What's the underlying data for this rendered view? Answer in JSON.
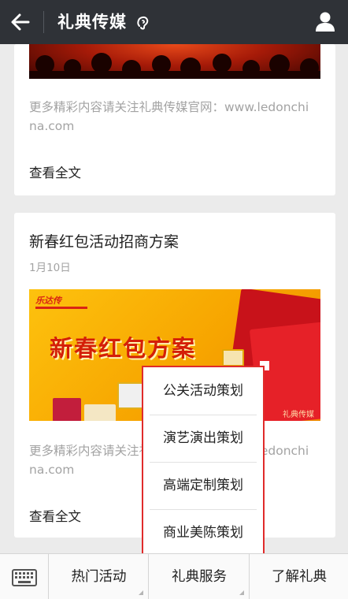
{
  "header": {
    "title": "礼典传媒"
  },
  "article1": {
    "summary": "更多精彩内容请关注礼典传媒官网：www.ledonchina.com",
    "read_more": "查看全文"
  },
  "article2": {
    "title": "新春红包活动招商方案",
    "date": "1月10日",
    "image_logo": "乐达传",
    "image_title": "新春红包方案",
    "image_corner": "礼典传媒",
    "summary": "更多精彩内容请关注礼典传媒官网：www.ledonchina.com",
    "read_more": "查看全文"
  },
  "popup_menu": {
    "items": [
      "公关活动策划",
      "演艺演出策划",
      "高端定制策划",
      "商业美陈策划"
    ]
  },
  "bottom_menu": {
    "tabs": [
      "热门活动",
      "礼典服务",
      "了解礼典"
    ]
  },
  "icons": {
    "back": "arrow-left-icon",
    "verified": "verified-ear-icon",
    "profile": "person-icon",
    "keyboard": "keyboard-icon"
  },
  "colors": {
    "topbar": "#2f3237",
    "highlight_border": "#e02b2b",
    "muted_text": "#a3a3a3"
  }
}
